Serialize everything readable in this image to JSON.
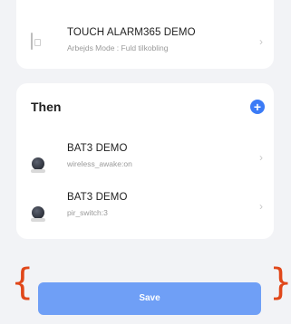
{
  "condition": {
    "device_name": "TOUCH ALARM365 DEMO",
    "detail": "Arbejds Mode : Fuld tilkobling",
    "icon": "device-outline-icon"
  },
  "then": {
    "title": "Then",
    "add_icon": "+",
    "actions": [
      {
        "device_name": "BAT3 DEMO",
        "detail": "wireless_awake:on",
        "icon": "motion-sensor-icon"
      },
      {
        "device_name": "BAT3 DEMO",
        "detail": "pir_switch:3",
        "icon": "motion-sensor-icon"
      }
    ]
  },
  "chevron": "›",
  "annotation": {
    "left": "{",
    "right": "}"
  },
  "save_label": "Save",
  "colors": {
    "accent": "#3b7bf6",
    "save_button": "#6f9ff6",
    "annotation": "#e0471a"
  }
}
